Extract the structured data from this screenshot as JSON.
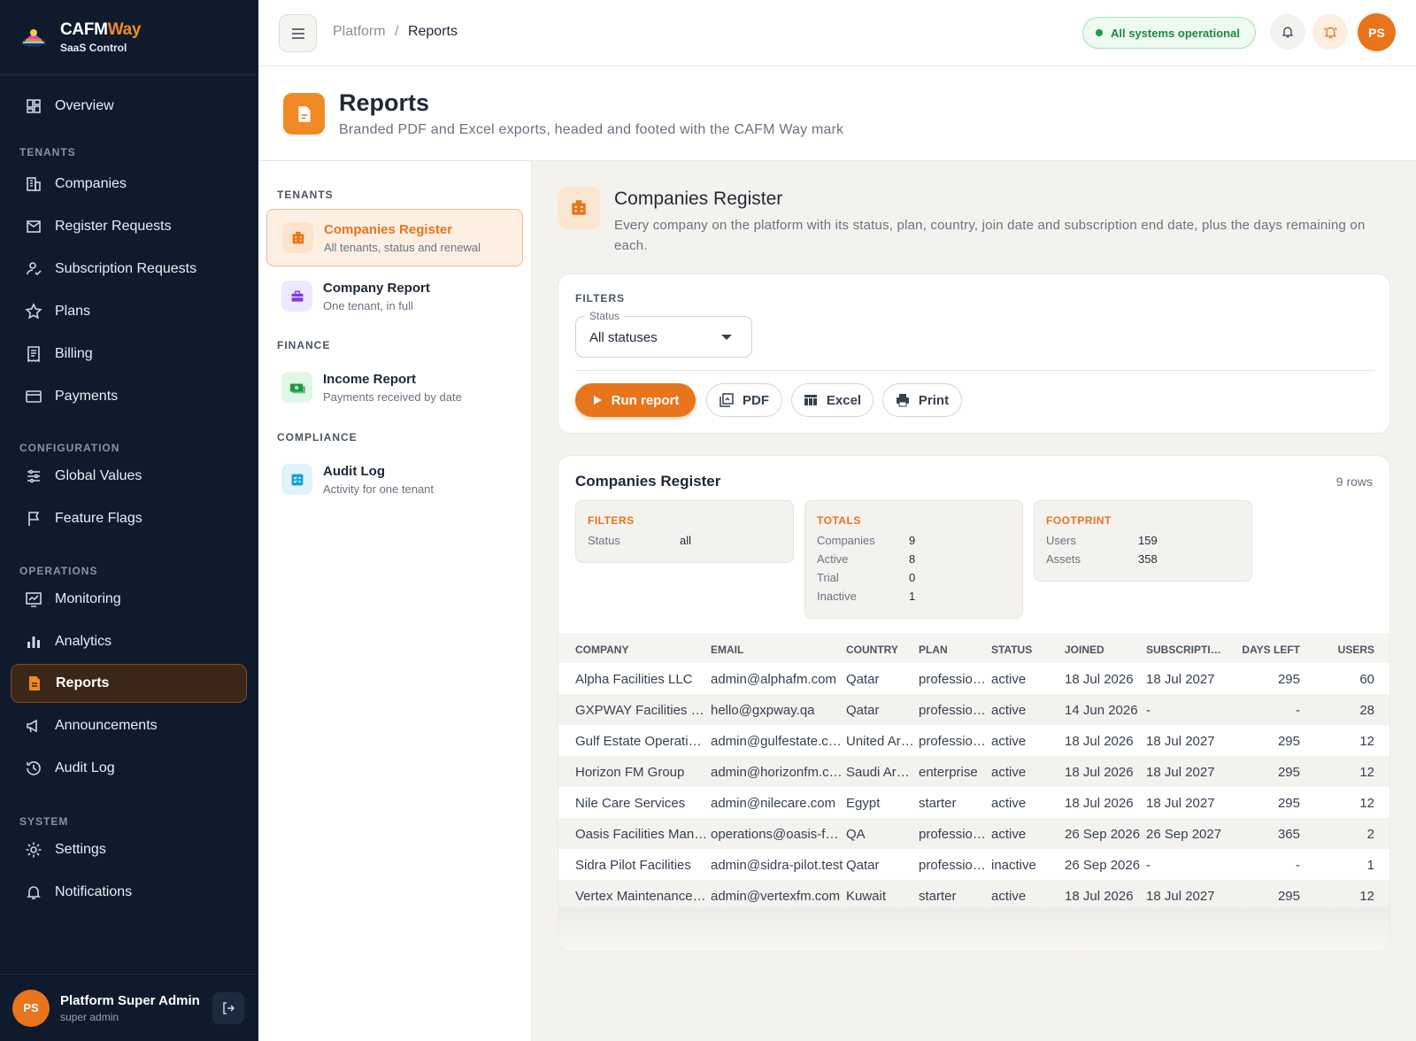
{
  "brand": {
    "name_a": "CAFM",
    "name_b": "Way",
    "sub": "SaaS Control"
  },
  "sidebar": {
    "overview": "Overview",
    "sections": {
      "tenants": "TENANTS",
      "configuration": "CONFIGURATION",
      "operations": "OPERATIONS",
      "system": "SYSTEM"
    },
    "items": [
      {
        "label": "Overview",
        "icon": "dashboard-icon"
      },
      {
        "label": "Companies",
        "icon": "building-icon"
      },
      {
        "label": "Register Requests",
        "icon": "mail-inbox-icon"
      },
      {
        "label": "Subscription Requests",
        "icon": "user-check-icon"
      },
      {
        "label": "Plans",
        "icon": "star-icon"
      },
      {
        "label": "Billing",
        "icon": "receipt-icon"
      },
      {
        "label": "Payments",
        "icon": "credit-card-icon"
      },
      {
        "label": "Global Values",
        "icon": "sliders-icon"
      },
      {
        "label": "Feature Flags",
        "icon": "flag-icon"
      },
      {
        "label": "Monitoring",
        "icon": "monitor-icon"
      },
      {
        "label": "Analytics",
        "icon": "bar-chart-icon"
      },
      {
        "label": "Reports",
        "icon": "report-icon"
      },
      {
        "label": "Announcements",
        "icon": "megaphone-icon"
      },
      {
        "label": "Audit Log",
        "icon": "history-icon"
      },
      {
        "label": "Settings",
        "icon": "gear-icon"
      },
      {
        "label": "Notifications",
        "icon": "bell-icon"
      }
    ],
    "user": {
      "initials": "PS",
      "name": "Platform Super Admin",
      "role": "super admin"
    }
  },
  "header": {
    "breadcrumb": {
      "parent": "Platform",
      "sep": "/",
      "current": "Reports"
    },
    "status": "All systems operational",
    "avatar": "PS"
  },
  "page": {
    "title": "Reports",
    "subtitle": "Branded PDF and Excel exports, headed and footed with the CAFM Way mark"
  },
  "report_list": {
    "sections": {
      "tenants": "TENANTS",
      "finance": "FINANCE",
      "compliance": "COMPLIANCE"
    },
    "items": [
      {
        "title": "Companies Register",
        "desc": "All tenants, status and renewal"
      },
      {
        "title": "Company Report",
        "desc": "One tenant, in full"
      },
      {
        "title": "Income Report",
        "desc": "Payments received by date"
      },
      {
        "title": "Audit Log",
        "desc": "Activity for one tenant"
      }
    ]
  },
  "detail": {
    "title": "Companies Register",
    "desc": "Every company on the platform with its status, plan, country, join date and subscription end date, plus the days remaining on each.",
    "filters_label": "FILTERS",
    "status_legend": "Status",
    "status_value": "All statuses",
    "buttons": {
      "run": "Run report",
      "pdf": "PDF",
      "excel": "Excel",
      "print": "Print"
    }
  },
  "result": {
    "title": "Companies Register",
    "row_count": "9 rows",
    "filters": {
      "head": "FILTERS",
      "rows": [
        {
          "k": "Status",
          "v": "all"
        }
      ]
    },
    "totals": {
      "head": "TOTALS",
      "rows": [
        {
          "k": "Companies",
          "v": "9"
        },
        {
          "k": "Active",
          "v": "8"
        },
        {
          "k": "Trial",
          "v": "0"
        },
        {
          "k": "Inactive",
          "v": "1"
        }
      ]
    },
    "footprint": {
      "head": "FOOTPRINT",
      "rows": [
        {
          "k": "Users",
          "v": "159"
        },
        {
          "k": "Assets",
          "v": "358"
        }
      ]
    },
    "columns": [
      "COMPANY",
      "EMAIL",
      "COUNTRY",
      "PLAN",
      "STATUS",
      "JOINED",
      "SUBSCRIPTION END",
      "DAYS LEFT",
      "USERS"
    ],
    "rows": [
      [
        "Alpha Facilities LLC",
        "admin@alphafm.com",
        "Qatar",
        "professional",
        "active",
        "18 Jul 2026",
        "18 Jul 2027",
        "295",
        "60"
      ],
      [
        "GXPWAY Facilities Management",
        "hello@gxpway.qa",
        "Qatar",
        "professional",
        "active",
        "14 Jun 2026",
        "-",
        "-",
        "28"
      ],
      [
        "Gulf Estate Operations",
        "admin@gulfestate.com",
        "United Arab Emirates",
        "professional",
        "active",
        "18 Jul 2026",
        "18 Jul 2027",
        "295",
        "12"
      ],
      [
        "Horizon FM Group",
        "admin@horizonfm.com",
        "Saudi Arabia",
        "enterprise",
        "active",
        "18 Jul 2026",
        "18 Jul 2027",
        "295",
        "12"
      ],
      [
        "Nile Care Services",
        "admin@nilecare.com",
        "Egypt",
        "starter",
        "active",
        "18 Jul 2026",
        "18 Jul 2027",
        "295",
        "12"
      ],
      [
        "Oasis Facilities Management",
        "operations@oasis-fm.qa",
        "QA",
        "professional",
        "active",
        "26 Sep 2026",
        "26 Sep 2027",
        "365",
        "2"
      ],
      [
        "Sidra Pilot Facilities",
        "admin@sidra-pilot.test",
        "Qatar",
        "professional",
        "inactive",
        "26 Sep 2026",
        "-",
        "-",
        "1"
      ],
      [
        "Vertex Maintenance Services",
        "admin@vertexfm.com",
        "Kuwait",
        "starter",
        "active",
        "18 Jul 2026",
        "18 Jul 2027",
        "295",
        "12"
      ]
    ]
  },
  "colors": {
    "accent": "#e8741c",
    "sidebar": "#0f1b2d",
    "success": "#1f9a45"
  }
}
